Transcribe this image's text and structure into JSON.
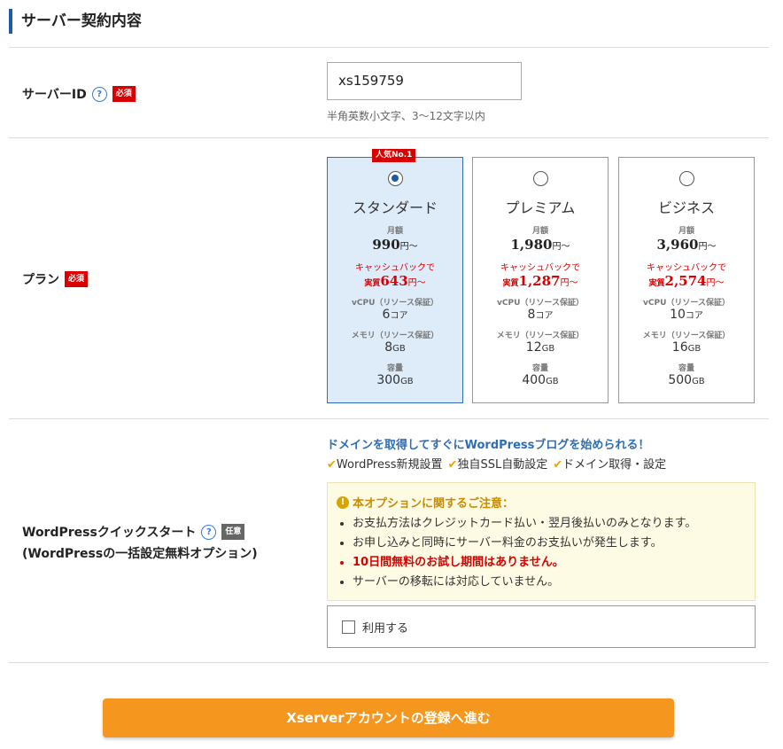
{
  "section_title": "サーバー契約内容",
  "server_id": {
    "label": "サーバーID",
    "required_badge": "必須",
    "value": "xs159759",
    "help": "半角英数小文字、3～12文字以内"
  },
  "plan": {
    "label": "プラン",
    "required_badge": "必須",
    "popular_badge": "人気No.1",
    "options": [
      {
        "name": "スタンダード",
        "selected": true,
        "monthly_label": "月額",
        "price": "990",
        "price_unit": "円～",
        "cashback_label": "キャッシュバックで",
        "effective_prefix": "実質",
        "effective_price": "643",
        "effective_unit": "円～",
        "vcpu_label": "vCPU（リソース保証）",
        "vcpu": "6",
        "vcpu_unit": "コア",
        "memory_label": "メモリ（リソース保証）",
        "memory": "8",
        "memory_unit": "GB",
        "storage_label": "容量",
        "storage": "300",
        "storage_unit": "GB"
      },
      {
        "name": "プレミアム",
        "selected": false,
        "monthly_label": "月額",
        "price": "1,980",
        "price_unit": "円～",
        "cashback_label": "キャッシュバックで",
        "effective_prefix": "実質",
        "effective_price": "1,287",
        "effective_unit": "円～",
        "vcpu_label": "vCPU（リソース保証）",
        "vcpu": "8",
        "vcpu_unit": "コア",
        "memory_label": "メモリ（リソース保証）",
        "memory": "12",
        "memory_unit": "GB",
        "storage_label": "容量",
        "storage": "400",
        "storage_unit": "GB"
      },
      {
        "name": "ビジネス",
        "selected": false,
        "monthly_label": "月額",
        "price": "3,960",
        "price_unit": "円～",
        "cashback_label": "キャッシュバックで",
        "effective_prefix": "実質",
        "effective_price": "2,574",
        "effective_unit": "円～",
        "vcpu_label": "vCPU（リソース保証）",
        "vcpu": "10",
        "vcpu_unit": "コア",
        "memory_label": "メモリ（リソース保証）",
        "memory": "16",
        "memory_unit": "GB",
        "storage_label": "容量",
        "storage": "500",
        "storage_unit": "GB"
      }
    ]
  },
  "wordpress": {
    "label": "WordPressクイックスタート",
    "label_sub": "(WordPressの一括設定無料オプション)",
    "optional_badge": "任意",
    "lead": "ドメインを取得してすぐにWordPressブログを始められる！",
    "features": [
      "WordPress新規設置",
      "独自SSL自動設定",
      "ドメイン取得・設定"
    ],
    "notice_title": "本オプションに関するご注意：",
    "notice_items": [
      "お支払方法はクレジットカード払い・翌月後払いのみとなります。",
      "お申し込みと同時にサーバー料金のお支払いが発生します。",
      "10日間無料のお試し期間はありません。",
      "サーバーの移転には対応していません。"
    ],
    "use_label": "利用する"
  },
  "submit_label": "Xserverアカウントの登録へ進む",
  "colors": {
    "accent": "#1f5aa6",
    "required": "#d80000",
    "submit": "#f5961e",
    "notice_bg": "#fefbe5"
  }
}
